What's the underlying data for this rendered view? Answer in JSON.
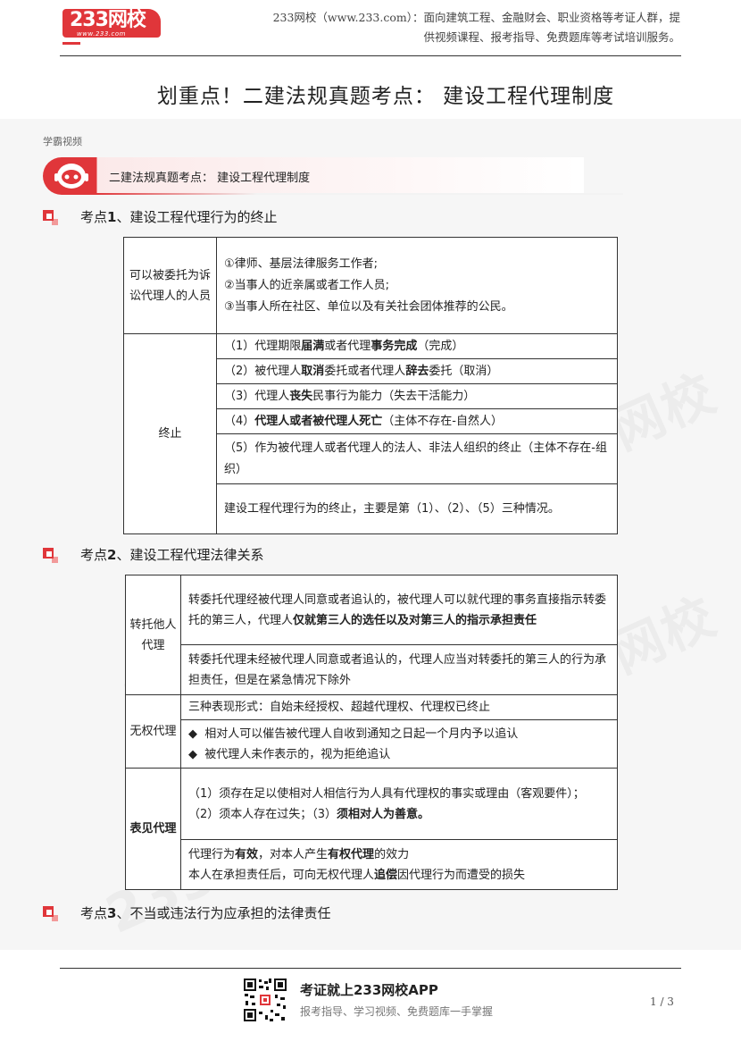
{
  "header": {
    "logo_text": "233网校",
    "logo_sub": "www.233.com",
    "info_line1": "233网校（www.233.com）：面向建筑工程、金融财会、职业资格等考证人群，提",
    "info_line2": "供视频课程、报考指导、免费题库等考试培训服务。"
  },
  "title": "划重点！二建法规真题考点： 建设工程代理制度",
  "video_label": "学霸视频",
  "video_banner": {
    "text": "二建法规真题考点： 建设工程代理制度",
    "icon": "robot-mascot-icon"
  },
  "section1": {
    "prefix": "考点",
    "num": "1",
    "title": "、建设工程代理行为的终止"
  },
  "table1": {
    "row1": {
      "label": "可以被委托为诉讼代理人的人员",
      "lines": [
        "①律师、基层法律服务工作者;",
        "②当事人的近亲属或者工作人员;",
        "③当事人所在社区、单位以及有关社会团体推荐的公民。"
      ]
    },
    "row2": {
      "label": "终止",
      "i1": [
        "（1）代理期限",
        "届满",
        "或者代理",
        "事务完成",
        "（完成）"
      ],
      "i2": [
        "（2）被代理人",
        "取消",
        "委托或者代理人",
        "辞去",
        "委托（取消）"
      ],
      "i3": [
        "（3）代理人",
        "丧失",
        "民事行为能力（失去干活能力）"
      ],
      "i4": [
        "（4）",
        "代理人或者被代理人死亡",
        "（主体不存在-自然人）"
      ],
      "i5": "（5）作为被代理人或者代理人的法人、非法人组织的终止（主体不存在-组织）",
      "summary": "建设工程代理行为的终止，主要是第（1）、（2）、（5）三种情况。"
    }
  },
  "section2": {
    "prefix": "考点",
    "num": "2",
    "title": "、建设工程代理法律关系"
  },
  "table2": {
    "row1": {
      "label": "转托他人代理",
      "a": [
        "转委托代理经被代理人同意或者追认的，被代理人可以就代理的事务直接指示转委托的第三人，代理人",
        "仅就第三人的选任以及对第三人的指示承担责任"
      ],
      "b": "转委托代理未经被代理人同意或者追认的，代理人应当对转委托的第三人的行为承担责任，但是在紧急情况下除外"
    },
    "row2": {
      "label": "无权代理",
      "a": "三种表现形式：自始未经授权、超越代理权、代理权已终止",
      "b1": "相对人可以催告被代理人自收到通知之日起一个月内予以追认",
      "b2": "被代理人未作表示的，视为拒绝追认",
      "bullet": "◆"
    },
    "row3": {
      "label": "表见代理",
      "a1": "（1）须存在足以使相对人相信行为人具有代理权的事实或理由（客观要件）；",
      "a2": [
        "（2）须本人存在过失；（3）",
        "须相对人为善意。"
      ],
      "b1": [
        "代理行为",
        "有效",
        "，对本人产生",
        "有权代理",
        "的效力"
      ],
      "b2": [
        "本人在承担责任后，可向无权代理人",
        "追偿",
        "因代理行为而遭受的损失"
      ]
    }
  },
  "section3": {
    "prefix": "考点",
    "num": "3",
    "title": "、不当或违法行为应承担的法律责任"
  },
  "footer": {
    "title": "考证就上233网校APP",
    "subtitle": "报考指导、学习视频、免费题库一手掌握",
    "page": "1 / 3",
    "qr_icon": "qr-code-icon"
  },
  "watermark": "233网校"
}
